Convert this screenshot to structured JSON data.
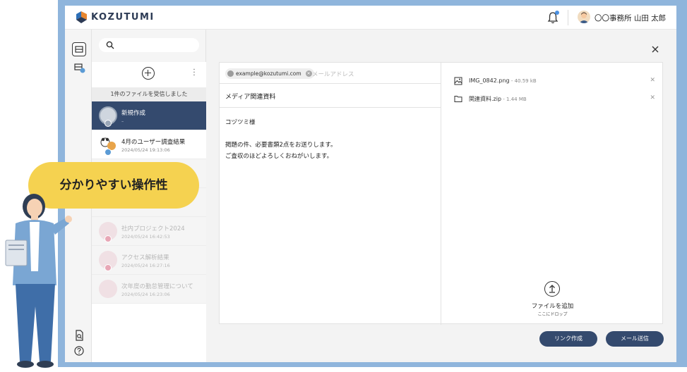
{
  "app": {
    "logo_text": "KOZUTUMI"
  },
  "header": {
    "user_name": "〇〇事務所 山田 太郎"
  },
  "file_list": {
    "received_banner": "1件のファイルを受信しました",
    "items": [
      {
        "title": "新規作成",
        "subtitle": "–"
      },
      {
        "title": "4月のユーザー調査結果",
        "subtitle": "2024/05/24 19:13:06"
      },
      {
        "title": "社内プロジェクト2024",
        "subtitle": "2024/05/24 16:42:53"
      },
      {
        "title": "アクセス解析結果",
        "subtitle": "2024/05/24 16:27:16"
      },
      {
        "title": "次年度の勤怠管理について",
        "subtitle": "2024/05/24 16:23:06"
      }
    ]
  },
  "composer": {
    "recipient_chip": "example@kozutumi.com",
    "email_placeholder": "メールアドレス",
    "subject": "メディア関連資料",
    "body": "コヅツミ様\n\n掲題の件、必要書類2点をお送りします。\nご査収のほどよろしくおねがいします。",
    "attachments": [
      {
        "name": "IMG_0842.png",
        "size": " - 40.59 kB",
        "icon": "image-file-icon"
      },
      {
        "name": "関連資料.zip",
        "size": " - 1.44 MB",
        "icon": "folder-icon"
      }
    ],
    "upload_label": "ファイルを追加",
    "upload_sub": "ここにドロップ",
    "link_button": "リンク作成",
    "send_button": "メール送信"
  },
  "callout": {
    "text": "分かりやすい操作性"
  },
  "colors": {
    "navy": "#344a6e",
    "frame": "#8fb5dc",
    "callout": "#f5d250"
  }
}
